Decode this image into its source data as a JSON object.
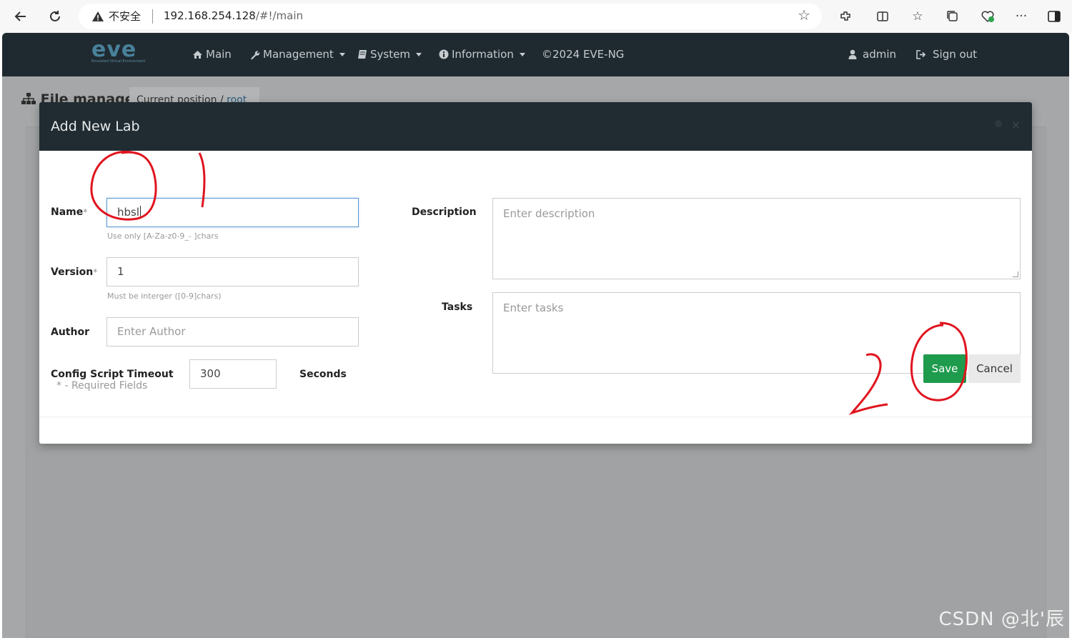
{
  "browser": {
    "insecure_label": "不安全",
    "url_host": "192.168.254.128",
    "url_path": "/#!/main"
  },
  "topnav": {
    "logo_text": "eve",
    "logo_sub": "Emulated Virtual Environment",
    "items": [
      {
        "label": "Main",
        "icon": "home-icon"
      },
      {
        "label": "Management",
        "icon": "wrench-icon"
      },
      {
        "label": "System",
        "icon": "system-icon"
      },
      {
        "label": "Information",
        "icon": "info-icon"
      },
      {
        "label": "©2024 EVE-NG"
      }
    ],
    "user": "admin",
    "signout": "Sign out"
  },
  "background": {
    "title": "File manager",
    "crumb_label": "Current position",
    "crumb_root": "root"
  },
  "modal": {
    "title": "Add New Lab",
    "close": "×",
    "name_label": "Name",
    "name_value": "hbsl",
    "name_help": "Use only [A-Za-z0-9_- ]chars",
    "version_label": "Version",
    "version_value": "1",
    "version_help": "Must be interger ([0-9]chars)",
    "author_label": "Author",
    "author_placeholder": "Enter Author",
    "timeout_label": "Config Script Timeout",
    "timeout_value": "300",
    "timeout_unit": "Seconds",
    "required_note": "* - Required Fields",
    "required_mark": "*",
    "description_label": "Description",
    "description_placeholder": "Enter description",
    "tasks_label": "Tasks",
    "tasks_placeholder": "Enter tasks",
    "save": "Save",
    "cancel": "Cancel"
  },
  "annotations": {
    "mark1": "1",
    "mark2": "2"
  },
  "watermark": "CSDN @北'辰",
  "colors": {
    "nav_bg": "#1f2a30",
    "save_green": "#1e9b4d",
    "annotation_red": "#e0141e",
    "focus_blue": "#5b9bd5"
  }
}
